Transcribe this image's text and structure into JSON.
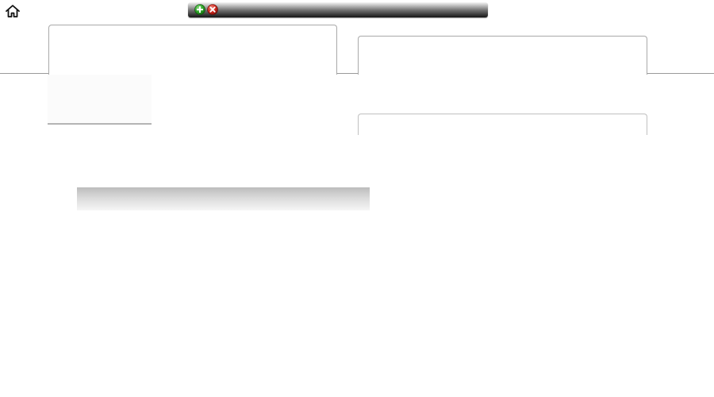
{
  "icons": {
    "home": "home-icon",
    "add": "plus-circle-icon",
    "close": "x-circle-icon"
  },
  "colors": {
    "add_green": "#2fa52a",
    "close_red": "#d2281e",
    "toolbar_dark": "#161616",
    "border_gray": "#a9a9a9"
  }
}
